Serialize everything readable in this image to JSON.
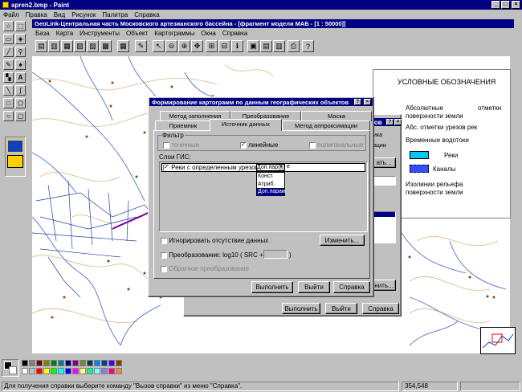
{
  "paint": {
    "title": "apren2.bmp - Paint",
    "menu": [
      "Файл",
      "Правка",
      "Вид",
      "Рисунок",
      "Палитра",
      "Справка"
    ],
    "status": "Для получения справки выберите команду \"Вызов справки\" из меню \"Справка\".",
    "coords": "354,548"
  },
  "geolink": {
    "title": "GeoLink-Центральная часть Московского артезианского бассейна - [фрагмент модели МАБ - [1 : 50000]]",
    "menu": [
      "База",
      "Карта",
      "Инструменты",
      "Объект",
      "Картограммы",
      "Окна",
      "Справка"
    ]
  },
  "legend": {
    "title": "УСЛОВНЫЕ ОБОЗНАЧЕНИЯ",
    "abs1": "Абсолютные",
    "abs_mark": "отметки",
    "abs2": "поверхности земли",
    "abs_river": "Абс. отметки урезов рек",
    "streams": "Временные водотоки",
    "rivers": "Реки",
    "canals": "Каналы",
    "contour1": "Изолинии рельефа",
    "contour2": "поверхности земли",
    "colors": {
      "rivers": "#00c8f0",
      "canals": "#3050ff"
    }
  },
  "dialog": {
    "title": "Формирование картограмм по данным географических объектов",
    "tabs_back": [
      "Метод заполнения",
      "Преобразование",
      "Маска"
    ],
    "tabs_front": [
      "Приемник",
      "Источник данных",
      "Метод аппроксимации"
    ],
    "filter_label": "Фильтр",
    "f_point": "точечные",
    "f_linear": "линейные",
    "f_polygon": "полигональные",
    "layers_label": "Слои ГИС:",
    "layer_name": "Реки с определенным урезом",
    "combo_value": "Доп.пар",
    "combo_trail": "е",
    "dropdown": [
      "Конст.",
      "Атриб.",
      "Доп.парам"
    ],
    "ignore_missing": "Игнорировать отсутствие данных",
    "change_btn": "Изменить...",
    "transform_label": "Преобразование:",
    "transform_formula": "log10 ( SRC +",
    "transform_close": ")",
    "inverse": "Обратное преобразование",
    "run": "Выполнить",
    "exit": "Выйти",
    "help": "Справка"
  },
  "back_dialog": {
    "title_frag": "тов",
    "run": "Выполнить",
    "exit": "Выйти",
    "help": "Справка",
    "b1": "ать...",
    "b2": "нить...",
    "t1": "ика",
    "t2": "ации"
  }
}
